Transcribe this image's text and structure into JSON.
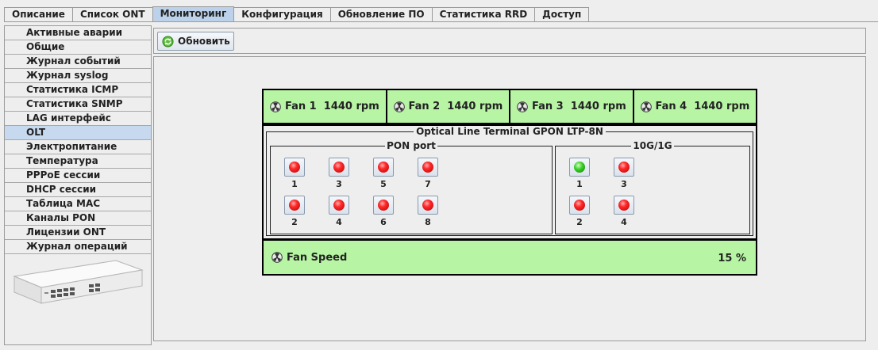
{
  "tabs": [
    {
      "label": "Описание"
    },
    {
      "label": "Список ONT"
    },
    {
      "label": "Мониторинг"
    },
    {
      "label": "Конфигурация"
    },
    {
      "label": "Обновление ПО"
    },
    {
      "label": "Статистика RRD"
    },
    {
      "label": "Доступ"
    }
  ],
  "active_tab": "Мониторинг",
  "sidebar": {
    "items": [
      {
        "label": "Активные аварии"
      },
      {
        "label": "Общие"
      },
      {
        "label": "Журнал событий"
      },
      {
        "label": "Журнал syslog"
      },
      {
        "label": "Статистика ICMP"
      },
      {
        "label": "Статистика SNMP"
      },
      {
        "label": "LAG интерфейс"
      },
      {
        "label": "OLT"
      },
      {
        "label": "Электропитание"
      },
      {
        "label": "Температура"
      },
      {
        "label": "PPPoE сессии"
      },
      {
        "label": "DHCP сессии"
      },
      {
        "label": "Таблица MAC"
      },
      {
        "label": "Каналы PON"
      },
      {
        "label": "Лицензии ONT"
      },
      {
        "label": "Журнал операций"
      }
    ],
    "active": "OLT"
  },
  "toolbar": {
    "refresh_label": "Обновить",
    "refresh_icon": "refresh-icon"
  },
  "fans": [
    {
      "label": "Fan 1  1440 rpm"
    },
    {
      "label": "Fan 2  1440 rpm"
    },
    {
      "label": "Fan 3  1440 rpm"
    },
    {
      "label": "Fan 4  1440 rpm"
    }
  ],
  "olt": {
    "title": "Optical Line Terminal GPON LTP-8N",
    "pon_group_title": "PON port",
    "uplink_group_title": "10G/1G",
    "pon_ports": [
      {
        "label": "1",
        "status": "red"
      },
      {
        "label": "3",
        "status": "red"
      },
      {
        "label": "5",
        "status": "red"
      },
      {
        "label": "7",
        "status": "red"
      },
      {
        "label": "2",
        "status": "red"
      },
      {
        "label": "4",
        "status": "red"
      },
      {
        "label": "6",
        "status": "red"
      },
      {
        "label": "8",
        "status": "red"
      }
    ],
    "uplink_ports": [
      {
        "label": "1",
        "status": "green"
      },
      {
        "label": "3",
        "status": "red"
      },
      {
        "label": "2",
        "status": "red"
      },
      {
        "label": "4",
        "status": "red"
      }
    ]
  },
  "fan_speed": {
    "label": "Fan Speed",
    "value": "15 %"
  },
  "colors": {
    "fan_bg": "#b7f5a5",
    "active_tab": "#bcd2ea",
    "active_menu": "#c7d9ee",
    "led_red": "#ff2a2a",
    "led_green": "#3cd12a"
  }
}
